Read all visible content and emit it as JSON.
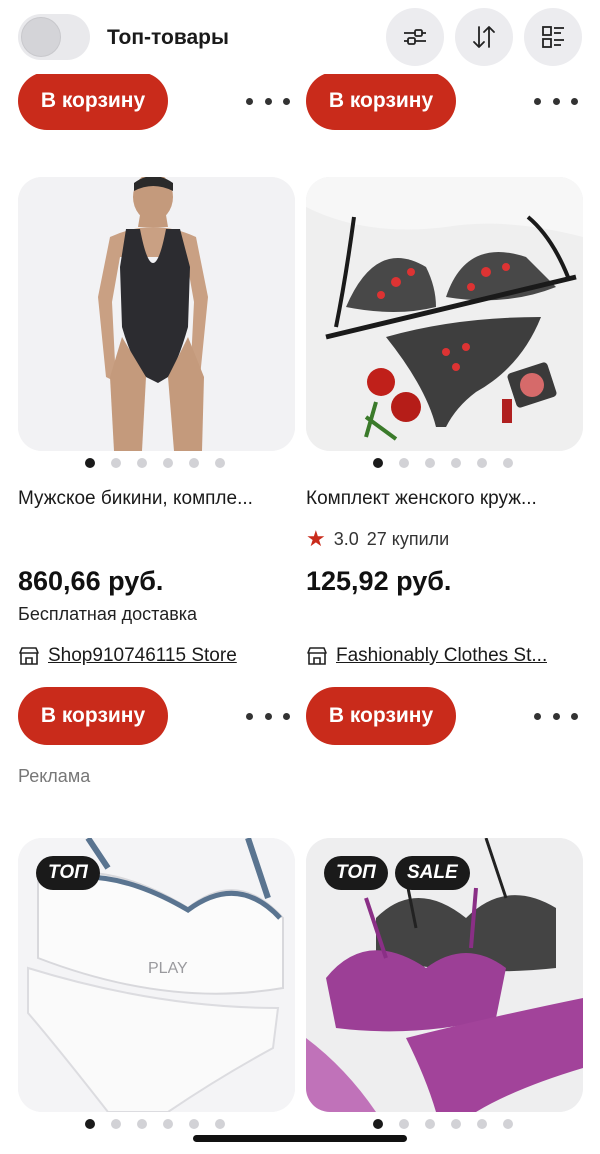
{
  "header": {
    "toggle_label": "Топ-товары",
    "toggle_on": false,
    "filter_icon": "sliders-icon",
    "sort_icon": "sort-icon",
    "view_icon": "grid-list-icon"
  },
  "top_row": {
    "left": {
      "cart_label": "В корзину"
    },
    "right": {
      "cart_label": "В корзину"
    }
  },
  "products": [
    {
      "name": "Мужское бикини, компле...",
      "rating": null,
      "sold": null,
      "price": "860,66 руб.",
      "delivery": "Бесплатная доставка",
      "store": "Shop910746115 Store",
      "cart_label": "В корзину",
      "dots": 6,
      "active_dot": 0
    },
    {
      "name": "Комплект женского круж...",
      "rating": "3.0",
      "sold": "27 купили",
      "price": "125,92 руб.",
      "delivery": "",
      "store": "Fashionably Clothes St...",
      "cart_label": "В корзину",
      "dots": 6,
      "active_dot": 0
    }
  ],
  "ad_label": "Реклама",
  "ad_products": [
    {
      "badges": [
        "ТОП"
      ],
      "dots": 6,
      "active_dot": 0
    },
    {
      "badges": [
        "ТОП",
        "SALE"
      ],
      "dots": 6,
      "active_dot": 0
    }
  ],
  "colors": {
    "accent": "#c92b1b",
    "badge_bg": "#1a1a1a",
    "muted": "#777777"
  }
}
